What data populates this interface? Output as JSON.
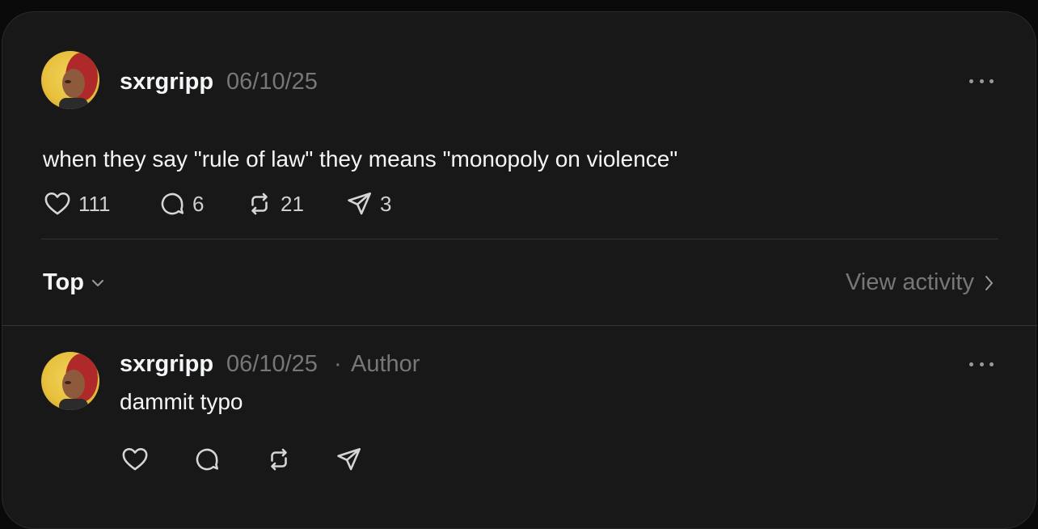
{
  "post": {
    "username": "sxrgripp",
    "date": "06/10/25",
    "text": "when they say \"rule of law\" they means \"monopoly on violence\"",
    "likes": "111",
    "comments": "6",
    "reposts": "21",
    "shares": "3"
  },
  "sort": {
    "label": "Top"
  },
  "activity": {
    "label": "View activity"
  },
  "reply": {
    "username": "sxrgripp",
    "date": "06/10/25",
    "separator": "·",
    "badge": "Author",
    "text": "dammit typo"
  },
  "icons": {
    "like": "heart-icon",
    "comment": "comment-bubble-icon",
    "repost": "repost-icon",
    "share": "paper-plane-icon",
    "more": "more-dots-icon"
  },
  "colors": {
    "background": "#181818",
    "text": "#f3f5f7",
    "muted": "#777777"
  }
}
